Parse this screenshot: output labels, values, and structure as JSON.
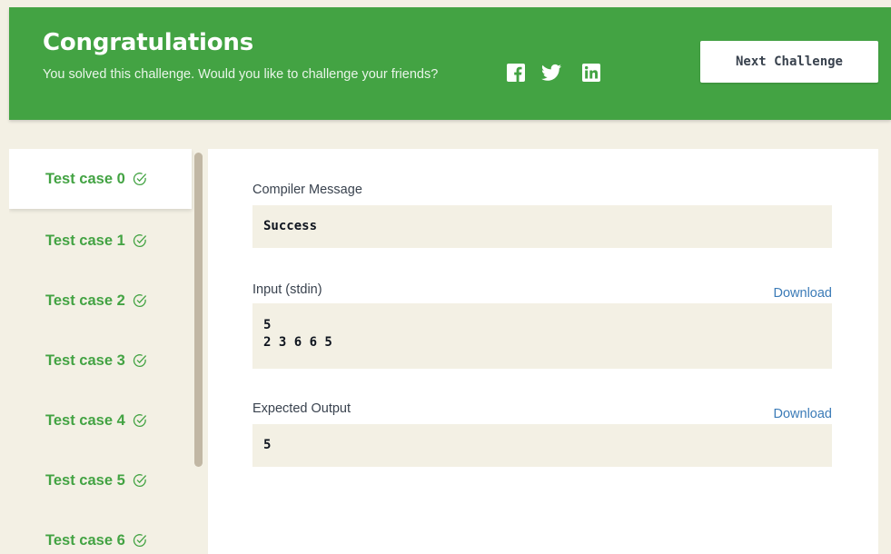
{
  "banner": {
    "title": "Congratulations",
    "subtitle": "You solved this challenge. Would you like to challenge your friends?",
    "share_icons": [
      "facebook-icon",
      "twitter-icon",
      "linkedin-icon"
    ],
    "next_button": "Next Challenge",
    "color": "#43a343"
  },
  "sidebar": {
    "test_cases": [
      {
        "label": "Test case 0",
        "passed": true,
        "active": true
      },
      {
        "label": "Test case 1",
        "passed": true,
        "active": false
      },
      {
        "label": "Test case 2",
        "passed": true,
        "active": false
      },
      {
        "label": "Test case 3",
        "passed": true,
        "active": false
      },
      {
        "label": "Test case 4",
        "passed": true,
        "active": false
      },
      {
        "label": "Test case 5",
        "passed": true,
        "active": false
      },
      {
        "label": "Test case 6",
        "passed": true,
        "active": false
      }
    ]
  },
  "result": {
    "compiler_label": "Compiler Message",
    "compiler_message": "Success",
    "input_label": "Input (stdin)",
    "input_download": "Download",
    "input_lines": [
      "5",
      "2 3 6 6 5"
    ],
    "expected_label": "Expected Output",
    "expected_download": "Download",
    "expected_lines": [
      "5"
    ]
  }
}
